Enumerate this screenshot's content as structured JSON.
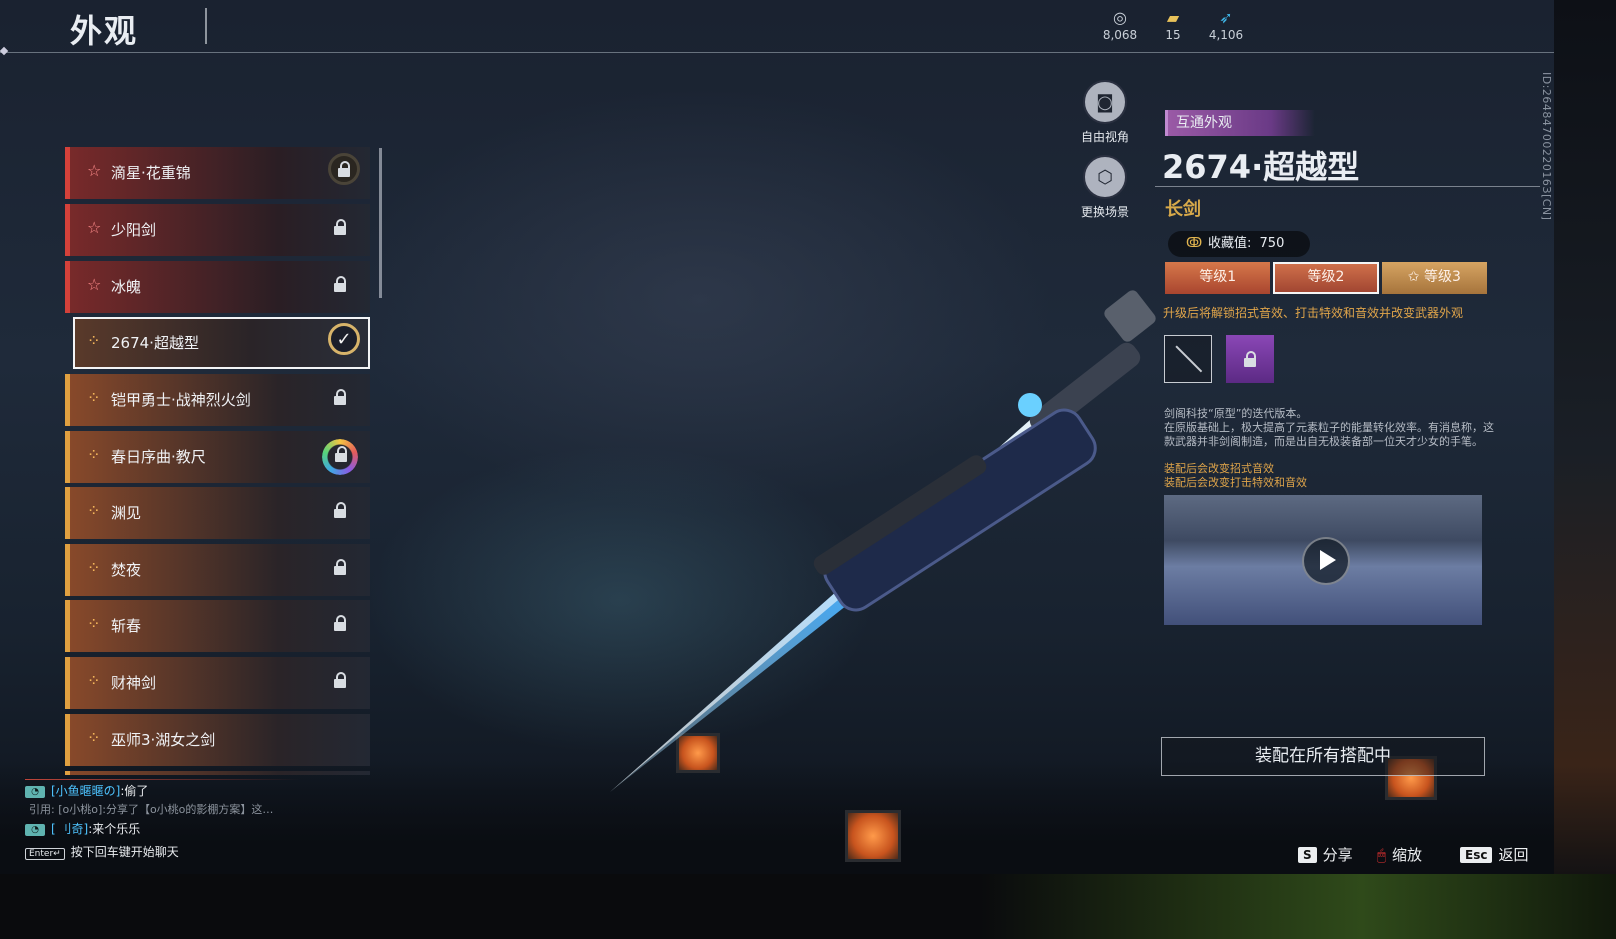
{
  "header": {
    "title": "外观"
  },
  "currencies": [
    {
      "icon": "coin-stack-icon",
      "value": "8,068"
    },
    {
      "icon": "ticket-icon",
      "value": "15"
    },
    {
      "icon": "feather-icon",
      "value": "4,106"
    }
  ],
  "player_id": "ID:2648470022016З[CN]",
  "skins": [
    {
      "name": "滴星·花重锦",
      "accent": "#d4413a",
      "state": "lock-ring"
    },
    {
      "name": "少阳剑",
      "accent": "#d4413a",
      "state": "lock"
    },
    {
      "name": "冰魄",
      "accent": "#d4413a",
      "state": "lock"
    },
    {
      "name": "2674·超越型",
      "accent": "#e0a040",
      "state": "equipped"
    },
    {
      "name": "铠甲勇士·战神烈火剑",
      "accent": "#e0a040",
      "state": "lock"
    },
    {
      "name": "春日序曲·教尺",
      "accent": "#e0a040",
      "state": "lock-rainbow"
    },
    {
      "name": "渊见",
      "accent": "#e0a040",
      "state": "lock"
    },
    {
      "name": "焚夜",
      "accent": "#e0a040",
      "state": "lock"
    },
    {
      "name": "斩春",
      "accent": "#e0a040",
      "state": "lock"
    },
    {
      "name": "财神剑",
      "accent": "#e0a040",
      "state": "lock"
    },
    {
      "name": "巫师3·湖女之剑",
      "accent": "#e0a040",
      "state": "none"
    }
  ],
  "side_buttons": [
    {
      "icon": "camera-icon",
      "label": "自由视角"
    },
    {
      "icon": "scene-cube-icon",
      "label": "更换场景"
    }
  ],
  "detail": {
    "tag": "互通外观",
    "name": "2674·超越型",
    "weapon_type": "长剑",
    "collect_label": "收藏值:",
    "collect_value": "750",
    "levels": [
      "等级1",
      "等级2",
      "等级3"
    ],
    "upgrade_note": "升级后将解锁招式音效、打击特效和音效并改变武器外观",
    "description": [
      "剑阁科技“原型”的迭代版本。",
      "在原版基础上，极大提高了元素粒子的能量转化效率。有消息称，这",
      "款武器并非剑阁制造，而是出自无极装备部一位天才少女的手笔。"
    ],
    "effects": [
      "装配后会改变招式音效",
      "装配后会改变打击特效和音效"
    ],
    "equip_button": "装配在所有搭配中"
  },
  "chat": {
    "line1_name": "[小鱼暱暱の]",
    "line1_text": ":偷了",
    "quote": "引用: [o小桃o]:分享了【o小桃o的影棚方案】这…",
    "line2_name": "[ 刂奇]",
    "line2_text": ":来个乐乐",
    "enter_key": "Enter↵",
    "enter_hint": "按下回车键开始聊天"
  },
  "hints": [
    {
      "key": "S",
      "label": "分享"
    },
    {
      "key": "🖱",
      "label": "缩放"
    },
    {
      "key": "Esc",
      "label": "返回"
    }
  ],
  "colors": {
    "accent_gold": "#d7a94a",
    "accent_red": "#d4413a",
    "equip_purple": "#8a47b6"
  }
}
